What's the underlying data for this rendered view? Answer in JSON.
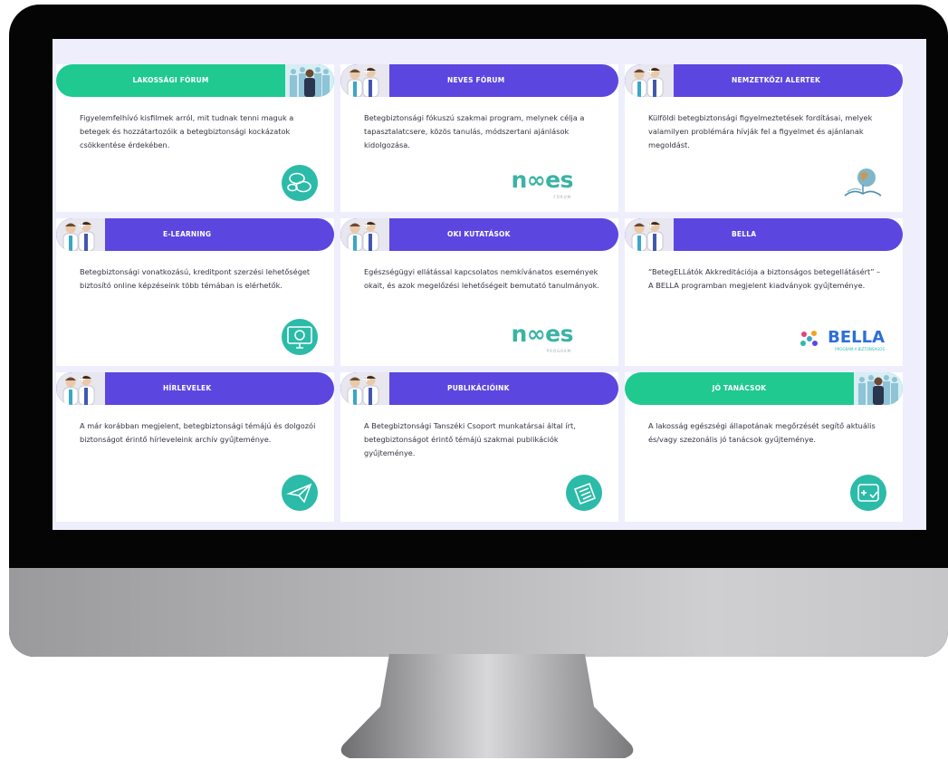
{
  "cards": [
    {
      "title": "LAKOSSÁGI FÓRUM",
      "theme": "green",
      "text": "Figyelemfelhívó kisfilmek arról, mit tudnak tenni maguk a betegek és hozzátartozóik a betegbiztonsági kockázatok csökkentése érdekében.",
      "icon": "speech-bubbles-icon"
    },
    {
      "title": "NEVES FÓRUM",
      "theme": "purple",
      "text": "Betegbiztonsági fókuszú szakmai program, melynek célja a tapasztalatcsere, közös tanulás, módszertani ajánlások kidolgozása.",
      "icon": "neves-logo",
      "logo_text": "n∞es",
      "logo_sub": "FÓRUM"
    },
    {
      "title": "NEMZETKÖZI ALERTEK",
      "theme": "purple",
      "text": "Külföldi betegbiztonsági figyelmeztetések fordításai, melyek valamilyen problémára hívják fel a figyelmet és ajánlanak megoldást.",
      "icon": "globe-book-icon"
    },
    {
      "title": "E-LEARNING",
      "theme": "purple",
      "text": "Betegbiztonsági vonatkozású, kreditpont szerzési lehetőséget biztosító online képzéseink több témában is elérhetők.",
      "icon": "monitor-icon"
    },
    {
      "title": "OKI KUTATÁSOK",
      "theme": "purple",
      "text": "Egészségügyi ellátással kapcsolatos nemkívánatos események okait, és azok megelőzési lehetőségeit bemutató tanulmányok.",
      "icon": "neves-logo",
      "logo_text": "n∞es",
      "logo_sub": "PROGRAM"
    },
    {
      "title": "BELLA",
      "theme": "purple",
      "text": "“BetegELLátók Akkreditációja a biztonságos betegellátásért” – A BELLA programban megjelent kiadványok gyűjteménye.",
      "icon": "bella-logo",
      "logo_text": "BELLA",
      "logo_sub": "PROGRAM A BIZTONSÁGOS"
    },
    {
      "title": "HÍRLEVELEK",
      "theme": "purple",
      "text": "A már korábban megjelent, betegbiztonsági témájú és dolgozói biztonságot érintő hírleveleink archív gyűjteménye.",
      "icon": "paper-plane-icon"
    },
    {
      "title": "PUBLIKÁCIÓINK",
      "theme": "purple",
      "text": "A Betegbiztonsági Tanszéki Csoport munkatársai által írt, betegbiztonságot érintő témájú szakmai publikációk gyűjteménye.",
      "icon": "documents-icon"
    },
    {
      "title": "JÓ TANÁCSOK",
      "theme": "green",
      "text": "A lakosság egészségi állapotának megőrzését segítő aktuális és/vagy szezonális jó tanácsok gyűjteménye.",
      "icon": "medical-card-icon"
    }
  ],
  "colors": {
    "purple": "#5c46e0",
    "green": "#1fc990",
    "teal": "#2bbba8",
    "page_bg": "#eeeefc"
  }
}
